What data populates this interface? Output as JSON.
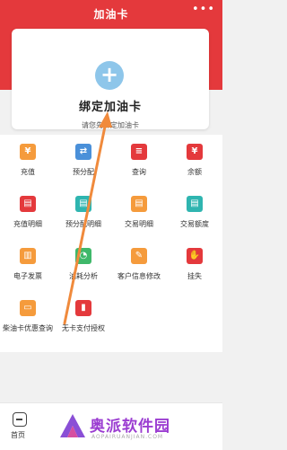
{
  "header": {
    "title": "加油卡",
    "more": "•••"
  },
  "card": {
    "plus": "+",
    "title": "绑定加油卡",
    "subtitle": "请您先绑定加油卡"
  },
  "grid": [
    {
      "label": "充值",
      "color": "orange",
      "glyph": "¥"
    },
    {
      "label": "预分配",
      "color": "blue",
      "glyph": "⇄"
    },
    {
      "label": "查询",
      "color": "red",
      "glyph": "≡"
    },
    {
      "label": "余额",
      "color": "red",
      "glyph": "¥"
    },
    {
      "label": "充值明细",
      "color": "red",
      "glyph": "▤"
    },
    {
      "label": "预分配明细",
      "color": "teal",
      "glyph": "▤"
    },
    {
      "label": "交易明细",
      "color": "orange",
      "glyph": "▤"
    },
    {
      "label": "交易额度",
      "color": "teal",
      "glyph": "▤"
    },
    {
      "label": "电子发票",
      "color": "orange",
      "glyph": "▥"
    },
    {
      "label": "油耗分析",
      "color": "green",
      "glyph": "◔"
    },
    {
      "label": "客户信息修改",
      "color": "orange",
      "glyph": "✎"
    },
    {
      "label": "挂失",
      "color": "red",
      "glyph": "✋"
    },
    {
      "label": "柴油卡优惠查询",
      "color": "orange",
      "glyph": "▭"
    },
    {
      "label": "无卡支付授权",
      "color": "red",
      "glyph": "▮"
    }
  ],
  "bottom": {
    "home_label": "首页"
  },
  "watermark": {
    "brand": "奥派软件园",
    "url": "AOPAIRUANJIAN.COM"
  }
}
